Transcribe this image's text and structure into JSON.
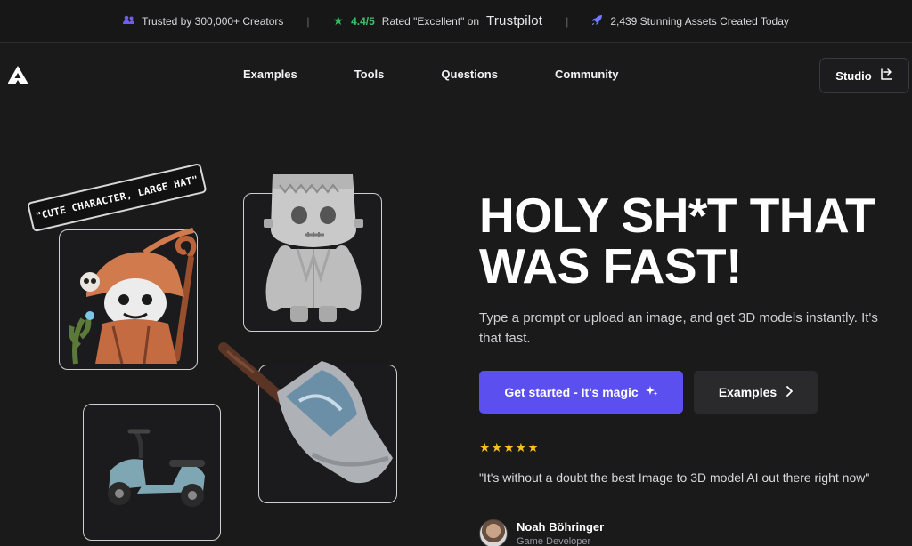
{
  "topbar": {
    "trusted": "Trusted by 300,000+ Creators",
    "separator": "|",
    "rating": "4.4/5",
    "rated_text": "Rated \"Excellent\" on",
    "trustpilot": "Trustpilot",
    "assets": "2,439 Stunning Assets Created Today",
    "icons": [
      "users-icon",
      "star-icon",
      "rocket-icon"
    ]
  },
  "nav": {
    "links": [
      "Examples",
      "Tools",
      "Questions",
      "Community"
    ],
    "studio_label": "Studio",
    "logo_icon": "app-logo-icon"
  },
  "hero": {
    "headline_line1": "HOLY SH*T THAT",
    "headline_line2": "WAS FAST!",
    "subtext": "Type a prompt or upload an image, and get 3D models instantly. It's that fast.",
    "cta_primary": "Get started - It's magic",
    "cta_secondary": "Examples"
  },
  "review": {
    "stars": "★★★★★",
    "quote": "\"It's without a doubt the best Image to 3D model AI out there right now\"",
    "name": "Noah Böhringer",
    "role": "Game Developer"
  },
  "gallery": {
    "prompt_tag": "\"CUTE CHARACTER, LARGE HAT\""
  },
  "colors": {
    "background": "#1a1a1b",
    "accent": "#5b4ff0",
    "rating_green": "#3fbf6a",
    "star_yellow": "#f7c01d"
  }
}
